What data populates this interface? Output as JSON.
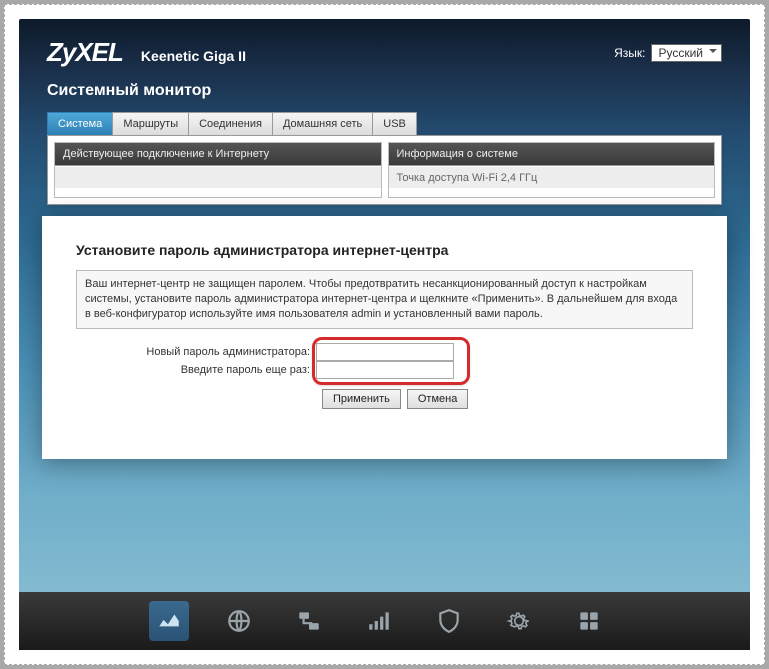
{
  "header": {
    "logo": "ZyXEL",
    "model": "Keenetic Giga II",
    "lang_label": "Язык:",
    "lang_value": "Русский"
  },
  "page": {
    "title": "Системный монитор"
  },
  "tabs": [
    {
      "label": "Система",
      "active": true
    },
    {
      "label": "Маршруты",
      "active": false
    },
    {
      "label": "Соединения",
      "active": false
    },
    {
      "label": "Домашняя сеть",
      "active": false
    },
    {
      "label": "USB",
      "active": false
    }
  ],
  "panels": {
    "left": {
      "title": "Действующее подключение к Интернету",
      "body": ""
    },
    "right": {
      "title": "Информация о системе",
      "body": "Точка доступа Wi-Fi 2,4 ГГц"
    }
  },
  "modal": {
    "title": "Установите пароль администратора интернет-центра",
    "info": "Ваш интернет-центр не защищен паролем. Чтобы предотвратить несанкционированный доступ к настройкам системы, установите пароль администратора интернет-центра и щелкните «Применить».\nВ дальнейшем для входа в веб-конфигуратор используйте имя пользователя admin и установленный вами пароль.",
    "field1_label": "Новый пароль администратора:",
    "field2_label": "Введите пароль еще раз:",
    "apply_label": "Применить",
    "cancel_label": "Отмена"
  },
  "nav_icons": [
    "monitor",
    "globe",
    "network",
    "signal",
    "shield",
    "gear",
    "apps"
  ]
}
